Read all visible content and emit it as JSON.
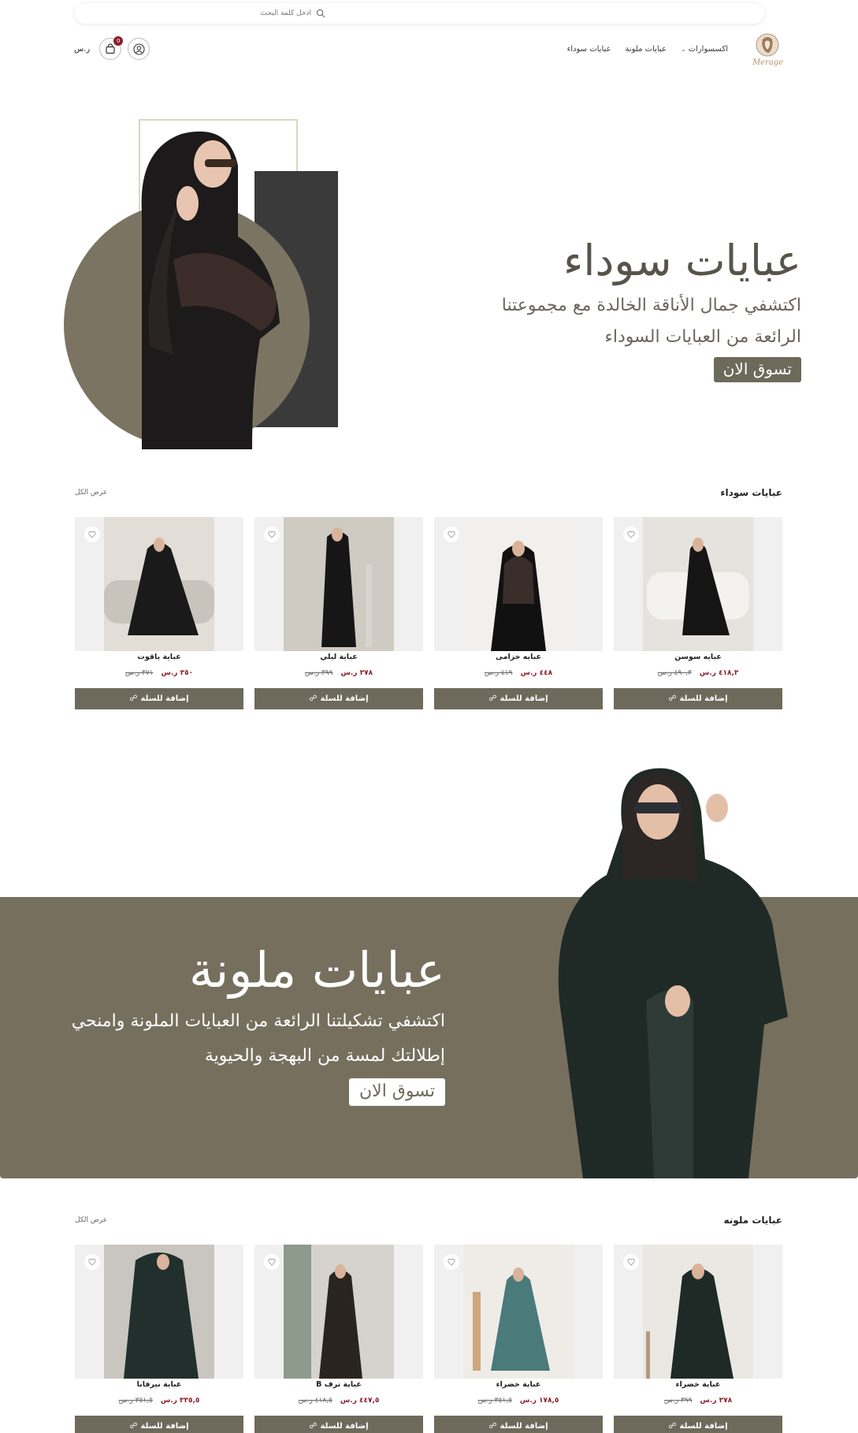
{
  "search": {
    "placeholder": "ادخل كلمة البحث"
  },
  "nav": {
    "items": [
      "عبايات سوداء",
      "عبايات ملونة",
      "اكسسوارات"
    ],
    "currency": "ر.س",
    "cart_count": "0"
  },
  "hero1": {
    "title": "عبايات سوداء",
    "line1": "اكتشفي جمال الأناقة الخالدة مع مجموعتنا",
    "line2": "الرائعة من العبايات السوداء",
    "cta": "تسوق الان"
  },
  "section1": {
    "title": "عبايات سوداء",
    "view_all": "عرض الكل",
    "products": [
      {
        "name": "عبايه سوسن",
        "price": "٤١٨,٣ ر.س",
        "old_price": "٤٩٠,٣ ر.س"
      },
      {
        "name": "عبايه خزامى",
        "price": "٤٤٨ ر.س",
        "old_price": "٤١٩ ر.س"
      },
      {
        "name": "عباية ليلي",
        "price": "٣٧٨ ر.س",
        "old_price": "٣٩٩ ر.س"
      },
      {
        "name": "عباية ياقوت",
        "price": "٣٥٠ ر.س",
        "old_price": "٣٧١ ر.س"
      }
    ],
    "add_label": "إضافة للسلة"
  },
  "hero2": {
    "title": "عبايات ملونة",
    "line1": "اكتشفي تشكيلتنا الرائعة من العبايات الملونة وامنحي",
    "line2": "إطلالتك لمسة من البهجة والحيوية",
    "cta": "تسوق الان"
  },
  "section2": {
    "title": "عبايات ملونه",
    "view_all": "عرض الكل",
    "products": [
      {
        "name": "عباية خضراء",
        "price": "٣٧٨ ر.س",
        "old_price": "٣٩٩ ر.س"
      },
      {
        "name": "عباية خضراء",
        "price": "١٧٨,٥ ر.س",
        "old_price": "٣٥١,٥ ر.س"
      },
      {
        "name": "عباية ترف B",
        "price": "٤٤٧,٥ ر.س",
        "old_price": "٤١٨,٥ ر.س"
      },
      {
        "name": "عباية نيرفانا",
        "price": "٣٣٥,٥ ر.س",
        "old_price": "٣٥١,٥ ر.س"
      }
    ],
    "add_label": "إضافة للسلة"
  },
  "colors": {
    "brand": "#6e6a5b",
    "band": "#776f5e",
    "sale": "#8b1e2b"
  }
}
